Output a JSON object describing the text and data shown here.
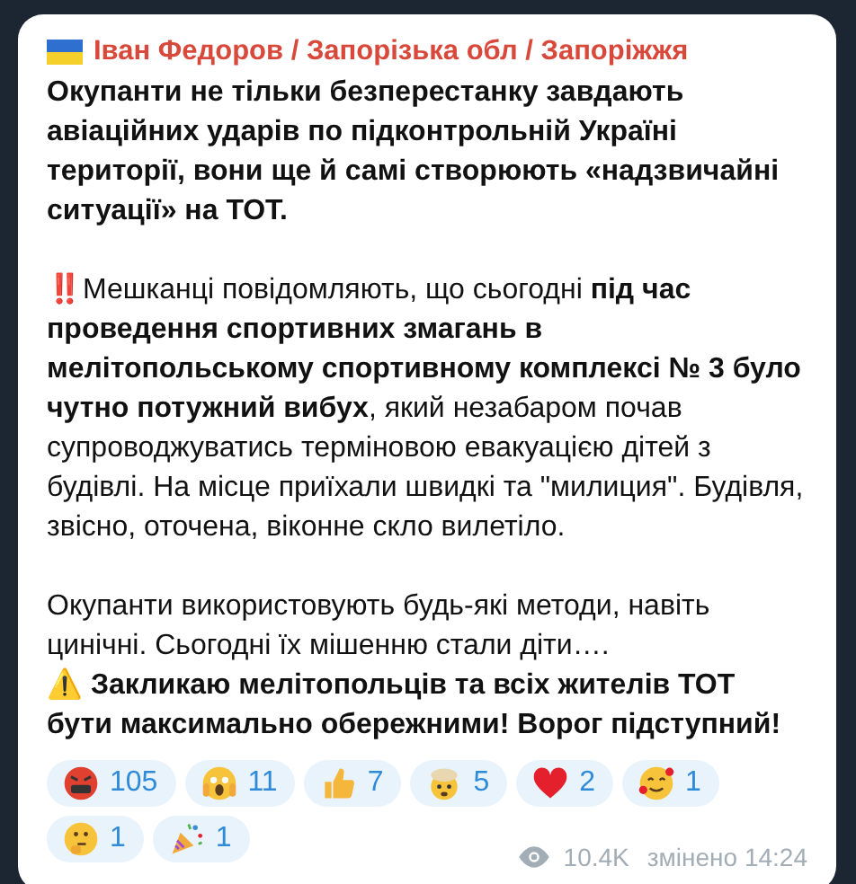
{
  "message": {
    "author": "Іван Федоров / Запорізька обл / Запоріжжя",
    "paragraphs": [
      {
        "lines": [
          {
            "text": "Окупанти не тільки безперестанку завдають авіаційних ударів по підконтрольній Україні території, вони ще й самі створюють «надзвичайні ситуації» на ТОТ.",
            "bold": true
          }
        ]
      },
      {
        "lines": [
          {
            "text": "‼️Мешканці повідомляють, що сьогодні **під час проведення спортивних змагань в мелітопольському спортивному комплексі № 3 було чутно потужний вибух**, який незабаром почав супроводжуватись терміновою евакуацією дітей з будівлі. На місце приїхали  швидкі та \"милиция\". Будівля, звісно, оточена, віконне скло вилетіло.",
            "bold": false
          }
        ]
      },
      {
        "lines": [
          {
            "text": "Окупанти використовують будь-які методи, навіть цинічні. Сьогодні їх мішенню стали діти….",
            "bold": false
          },
          {
            "text": "⚠️ Закликаю мелітопольців та всіх жителів ТОТ бути максимально обережними! Ворог підступний!",
            "bold": true
          }
        ]
      }
    ],
    "reactions": [
      {
        "kind": "angry",
        "count": "105"
      },
      {
        "kind": "scream",
        "count": "11"
      },
      {
        "kind": "thumbs",
        "count": "7"
      },
      {
        "kind": "exploding",
        "count": "5"
      },
      {
        "kind": "heart",
        "count": "2"
      },
      {
        "kind": "love",
        "count": "1"
      },
      {
        "kind": "thinking",
        "count": "1"
      },
      {
        "kind": "party",
        "count": "1"
      }
    ],
    "views": "10.4K",
    "edited": "змінено 14:24"
  }
}
